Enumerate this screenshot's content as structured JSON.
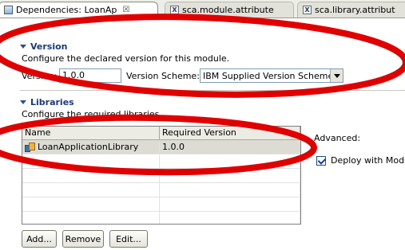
{
  "tabs": [
    {
      "label": "Dependencies: LoanAp",
      "close": "☒",
      "active": true
    },
    {
      "label": "sca.module.attribute",
      "active": false
    },
    {
      "label": "sca.library.attribut",
      "active": false
    }
  ],
  "version_section": {
    "title": "Version",
    "description": "Configure the declared version for this module.",
    "version_label": "Version:",
    "version_value": "1.0.0",
    "scheme_label": "Version Scheme:",
    "scheme_value": "IBM Supplied Version Scheme"
  },
  "libraries_section": {
    "title": "Libraries",
    "description": "Configure the required libraries.",
    "columns": [
      "Name",
      "Required Version"
    ],
    "rows": [
      {
        "name": "LoanApplicationLibrary",
        "version": "1.0.0"
      }
    ],
    "buttons": {
      "add": "Add...",
      "remove": "Remove",
      "edit": "Edit..."
    }
  },
  "advanced": {
    "label": "Advanced:",
    "deploy_label": "Deploy with Modul",
    "deploy_checked": true
  },
  "annotation_color": "#e00000"
}
